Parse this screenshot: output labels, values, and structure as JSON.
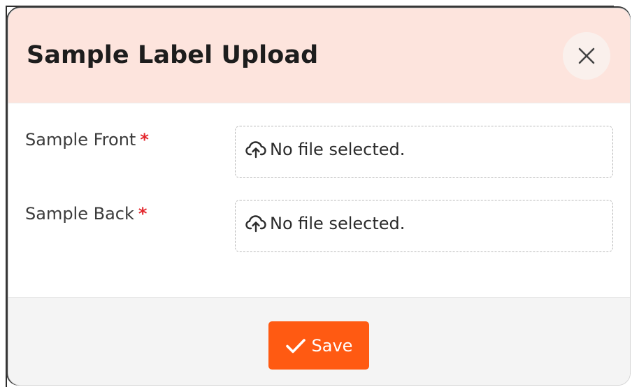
{
  "modal": {
    "title": "Sample Label Upload",
    "close_icon": "close-icon"
  },
  "fields": [
    {
      "label": "Sample Front",
      "required_mark": "*",
      "upload_icon": "cloud-upload-icon",
      "status": "No file selected."
    },
    {
      "label": "Sample Back",
      "required_mark": "*",
      "upload_icon": "cloud-upload-icon",
      "status": "No file selected."
    }
  ],
  "footer": {
    "save_label": "Save",
    "save_icon": "checkmark-icon"
  },
  "colors": {
    "header_bg": "#fde4dd",
    "accent": "#ff5a12",
    "required": "#e3262c",
    "footer_bg": "#f4f4f4"
  }
}
